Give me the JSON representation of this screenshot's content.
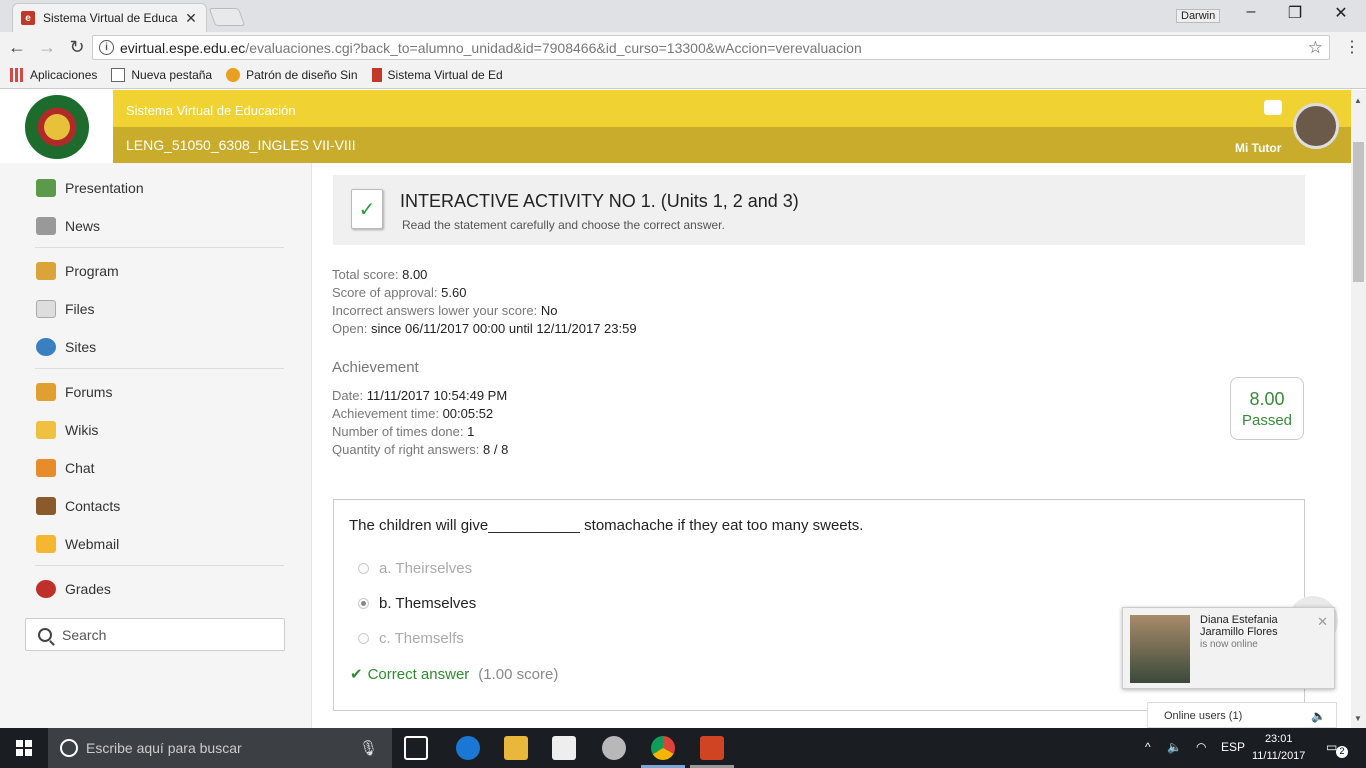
{
  "browser": {
    "tab_title": "Sistema Virtual de Educa",
    "tab_favicon": "e",
    "user": "Darwin",
    "url_host": "evirtual.espe.edu.ec",
    "url_path": "/evaluaciones.cgi?back_to=alumno_unidad&id=7908466&id_curso=13300&wAccion=verevaluacion",
    "bookmarks": [
      "Aplicaciones",
      "Nueva pestaña",
      "Patrón de diseño Sin",
      "Sistema Virtual de Ed"
    ]
  },
  "header": {
    "system_name": "Sistema Virtual de Educación",
    "course": "LENG_51050_6308_INGLES VII-VIII",
    "tutor_label": "Mi Tutor"
  },
  "sidebar": {
    "items": [
      "Presentation",
      "News",
      "Program",
      "Files",
      "Sites",
      "Forums",
      "Wikis",
      "Chat",
      "Contacts",
      "Webmail",
      "Grades"
    ],
    "search_placeholder": "Search"
  },
  "activity": {
    "title": "INTERACTIVE ACTIVITY NO 1. (Units 1, 2 and 3)",
    "subtitle": "Read the statement carefully and choose the correct answer."
  },
  "scores": {
    "total_label": "Total score:",
    "total": "8.00",
    "approval_label": "Score of approval:",
    "approval": "5.60",
    "incorrect_label": "Incorrect answers lower your score:",
    "incorrect": "No",
    "open_label": "Open:",
    "open": "since 06/11/2017 00:00 until 12/11/2017 23:59"
  },
  "achievement": {
    "title": "Achievement",
    "date_label": "Date:",
    "date": "11/11/2017 10:54:49 PM",
    "time_label": "Achievement time:",
    "time": "00:05:52",
    "times_label": "Number of times done:",
    "times": "1",
    "right_label": "Quantity of right answers:",
    "right": "8 / 8",
    "score": "8.00",
    "status": "Passed"
  },
  "question": {
    "text": "The children will give___________ stomachache if they eat too many sweets.",
    "options": [
      "a. Theirselves",
      "b. Themselves",
      "c. Themselfs"
    ],
    "selected_index": 1,
    "result": "Correct answer",
    "result_score": "(1.00 score)"
  },
  "notification": {
    "name": "Diana Estefania Jaramillo Flores",
    "status": "is now online",
    "online_users": "Online users (1)"
  },
  "taskbar": {
    "search_placeholder": "Escribe aquí para buscar",
    "lang": "ESP",
    "time": "23:01",
    "date": "11/11/2017",
    "notifications": "2"
  }
}
